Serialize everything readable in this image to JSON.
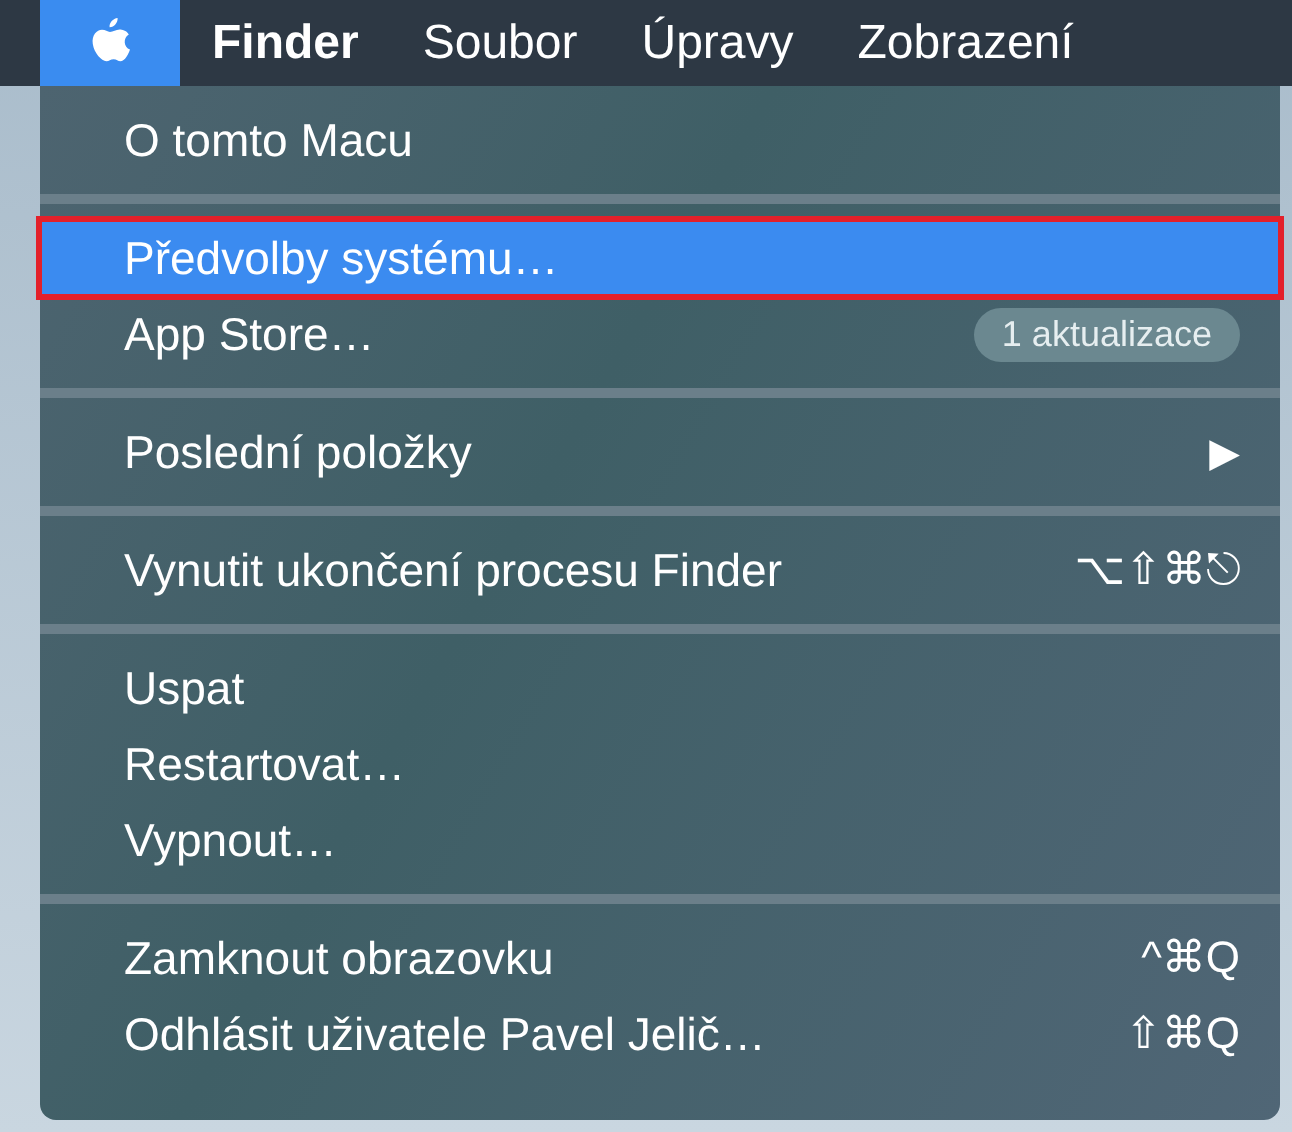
{
  "menu_bar": {
    "items": [
      {
        "kind": "apple",
        "selected": true
      },
      {
        "kind": "text",
        "label": "Finder",
        "selected": false
      },
      {
        "kind": "text",
        "label": "Soubor",
        "selected": false
      },
      {
        "kind": "text",
        "label": "Úpravy",
        "selected": false
      },
      {
        "kind": "text",
        "label": "Zobrazení",
        "selected": false
      }
    ]
  },
  "menu": {
    "groups": [
      {
        "items": [
          {
            "label": "O tomto Macu",
            "selected": false,
            "outlined": false
          }
        ]
      },
      {
        "items": [
          {
            "label": "Předvolby systému…",
            "selected": true,
            "outlined": true
          },
          {
            "label": "App Store…",
            "badge": "1 aktualizace",
            "selected": false,
            "outlined": false
          }
        ]
      },
      {
        "items": [
          {
            "label": "Poslední položky",
            "submenu": "▶",
            "selected": false,
            "outlined": false
          }
        ]
      },
      {
        "items": [
          {
            "label": "Vynutit ukončení procesu Finder",
            "shortcut": "⌥⇧⌘⎋",
            "selected": false,
            "outlined": false
          }
        ]
      },
      {
        "items": [
          {
            "label": "Uspat",
            "selected": false,
            "outlined": false
          },
          {
            "label": "Restartovat…",
            "selected": false,
            "outlined": false
          },
          {
            "label": "Vypnout…",
            "selected": false,
            "outlined": false
          }
        ]
      },
      {
        "items": [
          {
            "label": "Zamknout obrazovku",
            "shortcut": "^⌘Q",
            "selected": false,
            "outlined": false
          },
          {
            "label": "Odhlásit uživatele Pavel Jelič…",
            "shortcut": "⇧⌘Q",
            "selected": false,
            "outlined": false
          }
        ]
      }
    ]
  }
}
